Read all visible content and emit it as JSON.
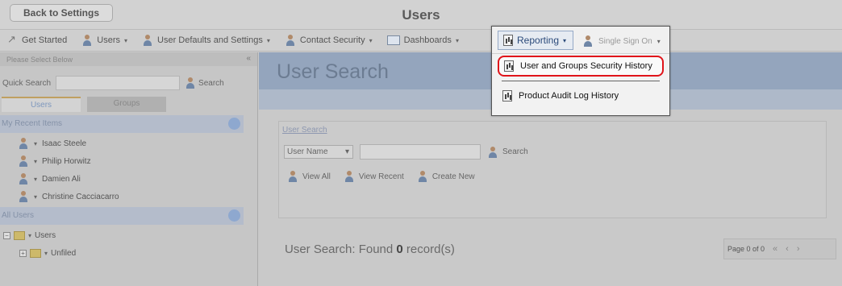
{
  "topbar": {
    "back_label": "Back to Settings",
    "title": "Users"
  },
  "menubar": {
    "items": [
      {
        "label": "Get Started",
        "icon": "rocket-icon"
      },
      {
        "label": "Users",
        "icon": "person-icon"
      },
      {
        "label": "User Defaults and Settings",
        "icon": "person-icon"
      },
      {
        "label": "Contact Security",
        "icon": "person-icon"
      },
      {
        "label": "Dashboards",
        "icon": "dashboard-icon"
      }
    ],
    "reporting_label": "Reporting",
    "sso_label": "Single Sign On"
  },
  "dropdown": {
    "items": [
      {
        "label": "User and Groups Security History",
        "icon": "report-icon",
        "highlighted": true
      },
      {
        "label": "Product Audit Log History",
        "icon": "report-icon"
      }
    ]
  },
  "sidebar": {
    "header": "Please Select Below",
    "collapse": "«",
    "quick_search_label": "Quick Search",
    "search_label": "Search",
    "tabs": [
      "Users",
      "Groups"
    ],
    "recent_title": "My Recent Items",
    "recent_items": [
      "Isaac Steele",
      "Philip Horwitz",
      "Damien Ali",
      "Christine Cacciacarro"
    ],
    "all_users_title": "All Users",
    "tree": [
      {
        "label": "Users",
        "expander": "−"
      },
      {
        "label": "Unfiled",
        "expander": "+"
      }
    ]
  },
  "main": {
    "title": "User Search",
    "search_link": "User Search",
    "field_select": "User Name",
    "search_button": "Search",
    "actions": [
      "View All",
      "View Recent",
      "Create New"
    ],
    "found_prefix": "User Search: Found",
    "found_count": "0",
    "found_suffix": "record(s)",
    "pager_label": "Page 0 of 0",
    "pager_nav": [
      "«",
      "‹",
      "›"
    ]
  }
}
